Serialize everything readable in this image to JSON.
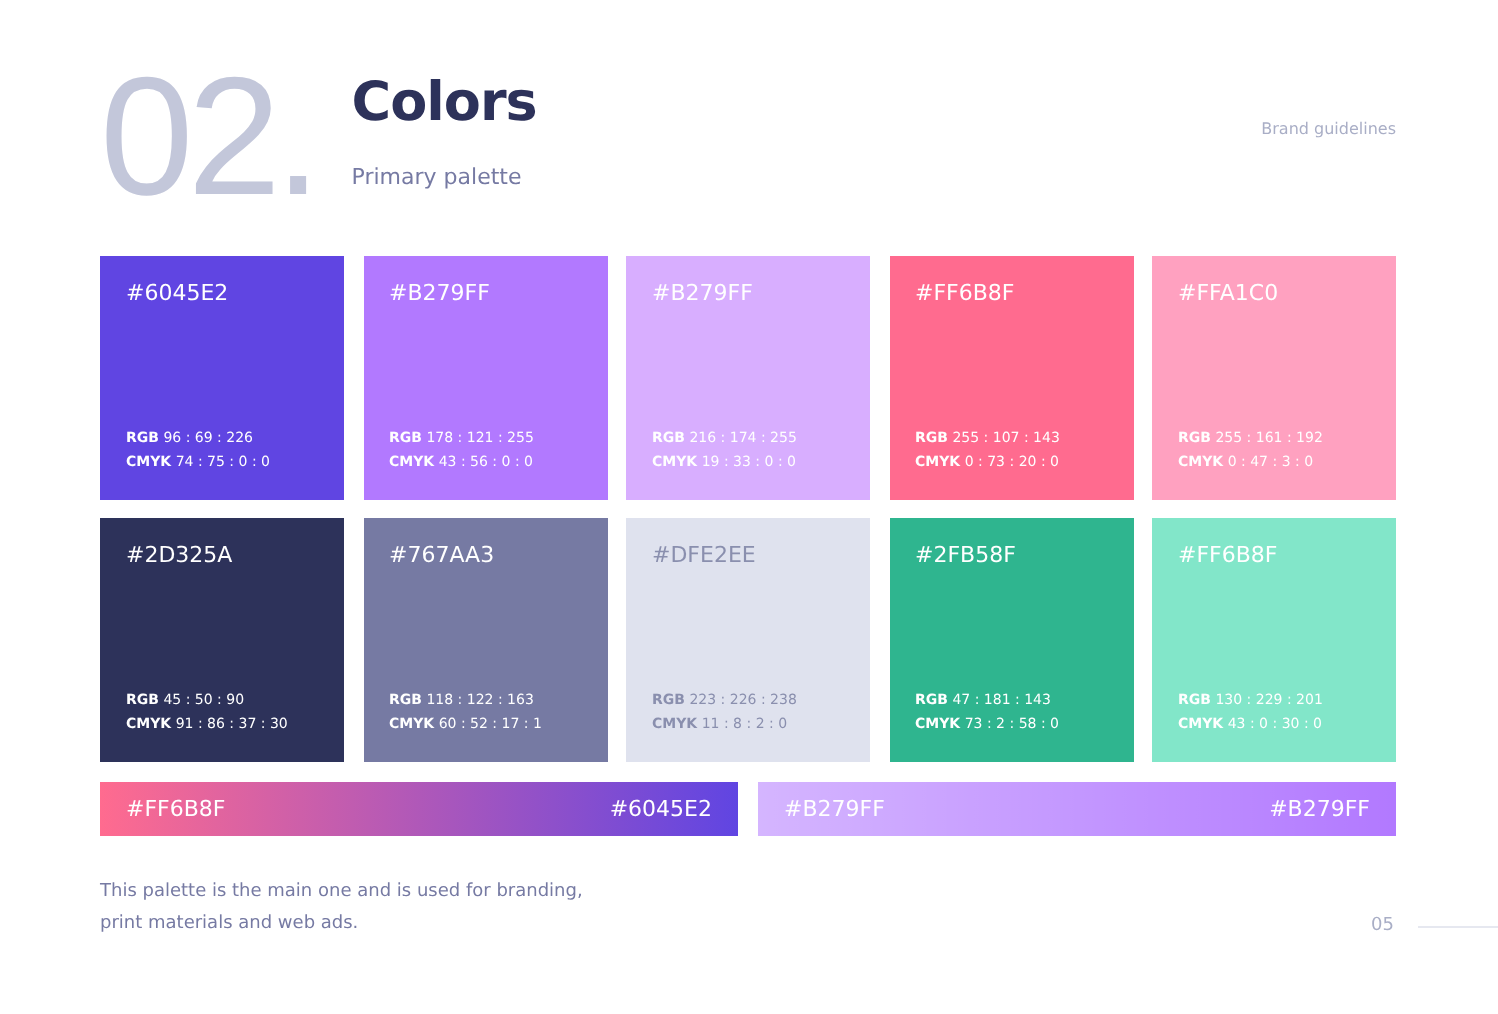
{
  "section_number": "02.",
  "title": "Colors",
  "subtitle": "Primary palette",
  "header_label": "Brand guidelines",
  "swatches": [
    {
      "hex": "#6045E2",
      "color": "#6045e2",
      "dark_text": false,
      "rgb_label": "RGB",
      "rgb": "96 : 69 : 226",
      "cmyk_label": "CMYK",
      "cmyk": "74 : 75 : 0 : 0"
    },
    {
      "hex": "#B279FF",
      "color": "#b279ff",
      "dark_text": false,
      "rgb_label": "RGB",
      "rgb": "178 : 121 : 255",
      "cmyk_label": "CMYK",
      "cmyk": "43 : 56 : 0 : 0"
    },
    {
      "hex": "#B279FF",
      "color": "#d8aeff",
      "dark_text": false,
      "rgb_label": "RGB",
      "rgb": "216 : 174 : 255",
      "cmyk_label": "CMYK",
      "cmyk": "19 : 33 : 0 : 0"
    },
    {
      "hex": "#FF6B8F",
      "color": "#ff6b8f",
      "dark_text": false,
      "rgb_label": "RGB",
      "rgb": "255 : 107 : 143",
      "cmyk_label": "CMYK",
      "cmyk": "0 : 73 : 20 : 0"
    },
    {
      "hex": "#FFA1C0",
      "color": "#ffa1c0",
      "dark_text": false,
      "rgb_label": "RGB",
      "rgb": "255 : 161 : 192",
      "cmyk_label": "CMYK",
      "cmyk": "0 : 47 : 3 : 0"
    },
    {
      "hex": "#2D325A",
      "color": "#2d325a",
      "dark_text": false,
      "rgb_label": "RGB",
      "rgb": "45 : 50 : 90",
      "cmyk_label": "CMYK",
      "cmyk": "91 : 86 : 37 : 30"
    },
    {
      "hex": "#767AA3",
      "color": "#767aa3",
      "dark_text": false,
      "rgb_label": "RGB",
      "rgb": "118 : 122 : 163",
      "cmyk_label": "CMYK",
      "cmyk": "60 : 52 : 17 : 1"
    },
    {
      "hex": "#DFE2EE",
      "color": "#dfe2ee",
      "dark_text": true,
      "rgb_label": "RGB",
      "rgb": "223 : 226 : 238",
      "cmyk_label": "CMYK",
      "cmyk": "11 : 8 : 2 : 0"
    },
    {
      "hex": "#2FB58F",
      "color": "#2fb58f",
      "dark_text": false,
      "rgb_label": "RGB",
      "rgb": "47 : 181 : 143",
      "cmyk_label": "CMYK",
      "cmyk": "73 : 2 : 58 : 0"
    },
    {
      "hex": "#FF6B8F",
      "color": "#82e6c9",
      "dark_text": false,
      "rgb_label": "RGB",
      "rgb": "130 : 229 : 201",
      "cmyk_label": "CMYK",
      "cmyk": "43 : 0 : 30 : 0"
    }
  ],
  "gradients": [
    {
      "start_label": "#FF6B8F",
      "end_label": "#6045E2"
    },
    {
      "start_label": "#B279FF",
      "end_label": "#B279FF"
    }
  ],
  "description": "This palette is the main one and is used for branding, print materials and web ads.",
  "page_number": "05"
}
